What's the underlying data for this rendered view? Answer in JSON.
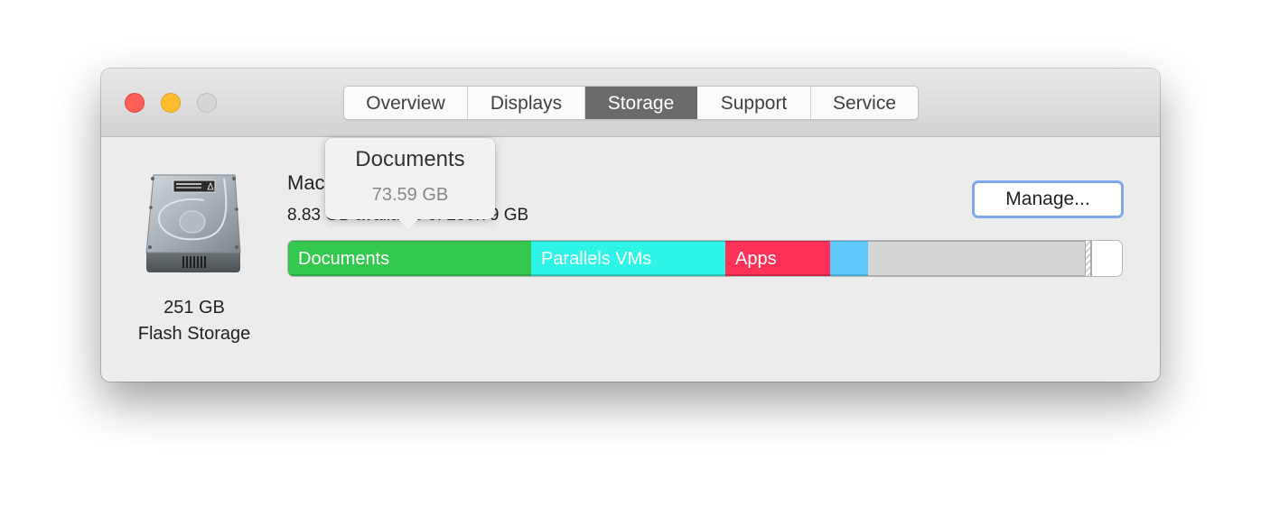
{
  "window": {
    "traffic_lights": [
      "close",
      "minimize",
      "zoom"
    ]
  },
  "tabs": [
    {
      "label": "Overview",
      "active": false
    },
    {
      "label": "Displays",
      "active": false
    },
    {
      "label": "Storage",
      "active": true
    },
    {
      "label": "Support",
      "active": false
    },
    {
      "label": "Service",
      "active": false
    }
  ],
  "disk": {
    "icon": "hard-drive-icon",
    "capacity": "251 GB",
    "type": "Flash Storage"
  },
  "volume": {
    "name": "Macintosh HD",
    "availability": "8.83 GB available of 250.79 GB"
  },
  "manage_button": "Manage...",
  "storage_bar": {
    "segments": [
      {
        "label": "Documents",
        "color": "#34c94e"
      },
      {
        "label": "Parallels VMs",
        "color": "#2ff5e6"
      },
      {
        "label": "Apps",
        "color": "#fe3158"
      },
      {
        "label": "",
        "color": "#5ec8f8"
      },
      {
        "label": "",
        "color": "#d6d6d6"
      }
    ]
  },
  "tooltip": {
    "title": "Documents",
    "value": "73.59 GB"
  },
  "colors": {
    "accent_focus": "#7ea7ec",
    "active_tab": "#6b6b6b"
  }
}
